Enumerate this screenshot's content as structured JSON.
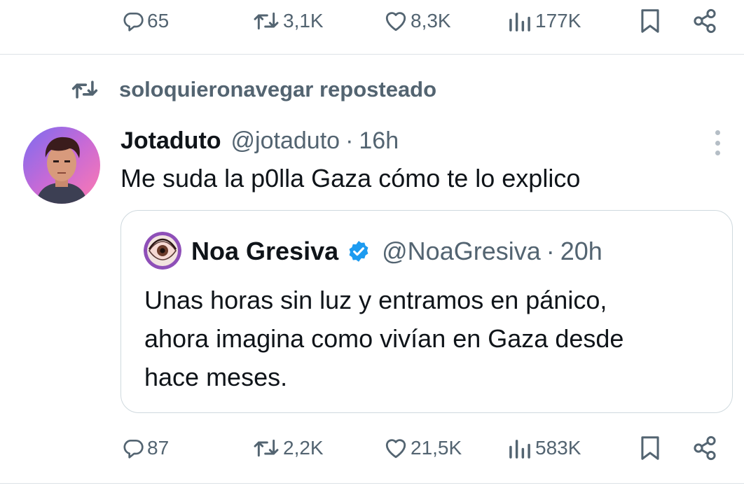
{
  "top_actions": {
    "replies": "65",
    "reposts": "3,1K",
    "likes": "8,3K",
    "views": "177K"
  },
  "repost_banner": {
    "icon": "repost-icon",
    "text": "soloquieronavegar reposteado"
  },
  "tweet": {
    "display_name": "Jotaduto",
    "handle": "@jotaduto",
    "separator": "·",
    "time": "16h",
    "text": "Me suda la p0lla Gaza cómo te lo explico",
    "quote": {
      "display_name": "Noa Gresiva",
      "verified": true,
      "handle": "@NoaGresiva",
      "separator": "·",
      "time": "20h",
      "text_lines": [
        "Unas horas sin luz y entramos en pánico,",
        "ahora imagina como vivían en Gaza desde",
        "hace meses."
      ]
    },
    "actions": {
      "replies": "87",
      "reposts": "2,2K",
      "likes": "21,5K",
      "views": "583K"
    }
  },
  "colors": {
    "text": "#0f1419",
    "muted": "#536471",
    "verified": "#1d9bf0",
    "divider": "#dde2e6"
  }
}
